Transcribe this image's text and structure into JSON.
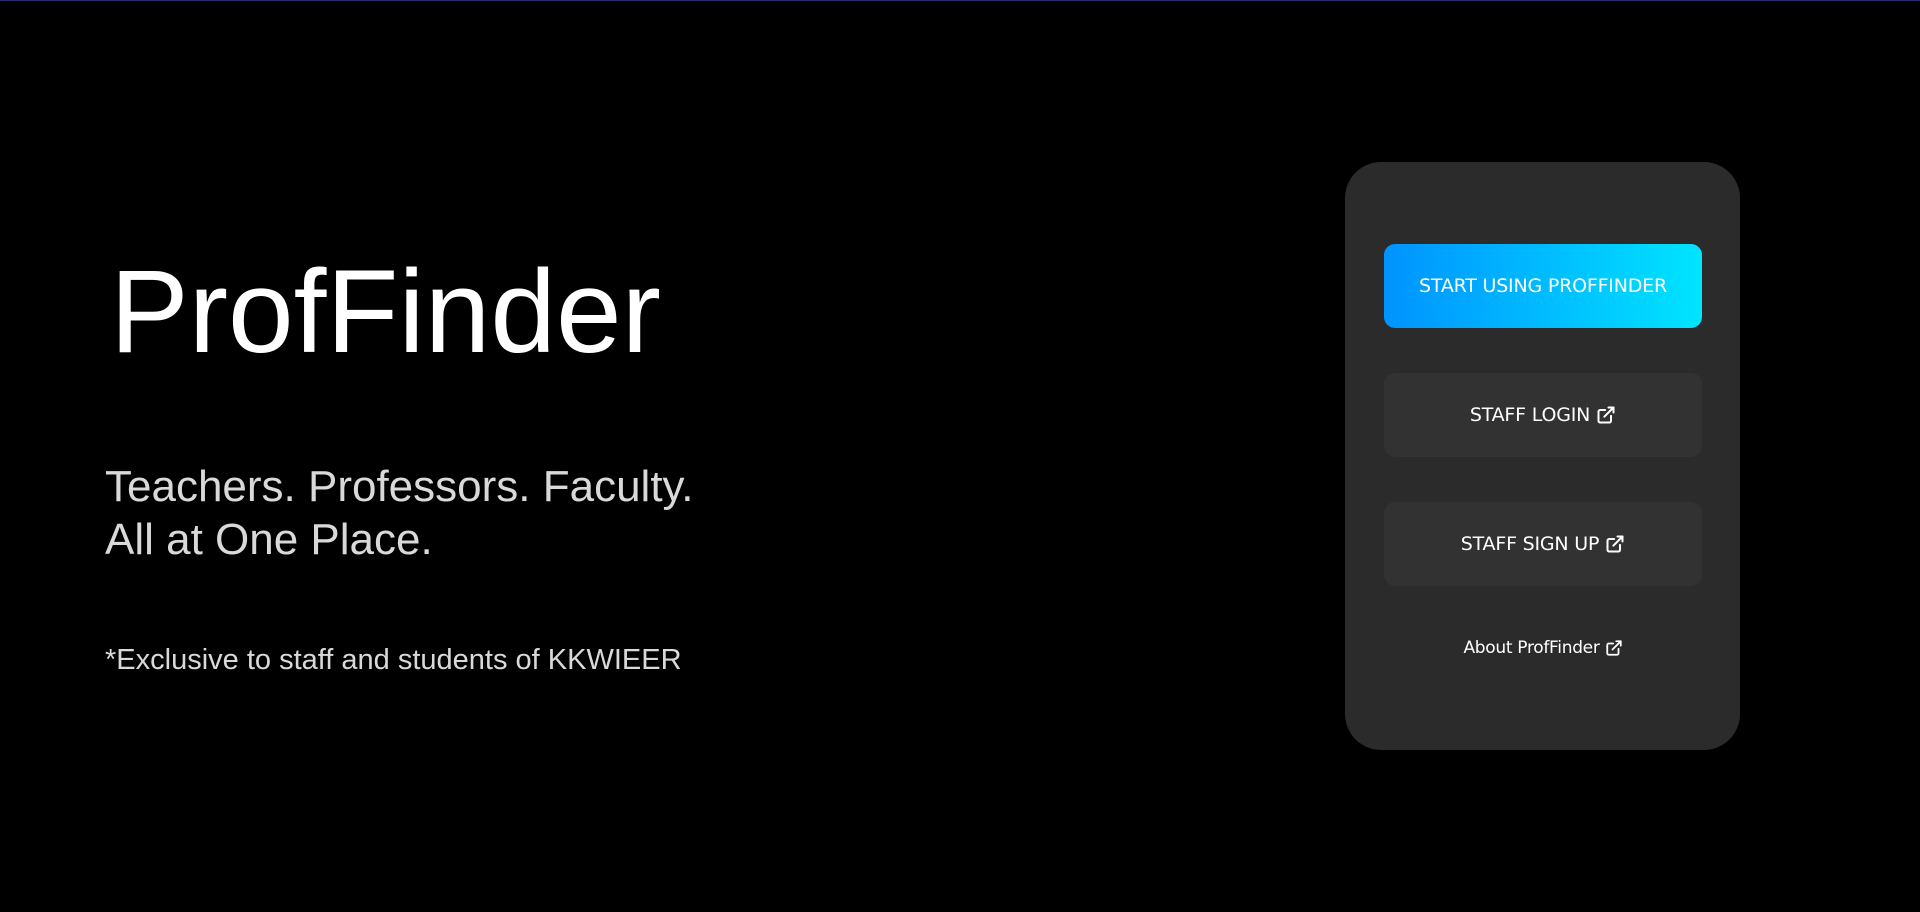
{
  "hero": {
    "title": "ProfFinder",
    "tagline_line1": "Teachers. Professors. Faculty.",
    "tagline_line2": "All at One Place.",
    "note": "*Exclusive to staff and students of KKWIEER"
  },
  "actions": {
    "start_label": "START USING PROFFINDER",
    "staff_login_label": "STAFF LOGIN",
    "staff_signup_label": "STAFF SIGN UP",
    "about_label": "About ProfFinder",
    "external_icon": "external-link-icon"
  },
  "colors": {
    "background": "#000000",
    "card": "#2b2b2b",
    "secondary_button": "#323232",
    "primary_gradient_start": "#0093ff",
    "primary_gradient_end": "#00e4ff",
    "text_primary": "#ffffff",
    "text_secondary": "#d9d9d9"
  }
}
